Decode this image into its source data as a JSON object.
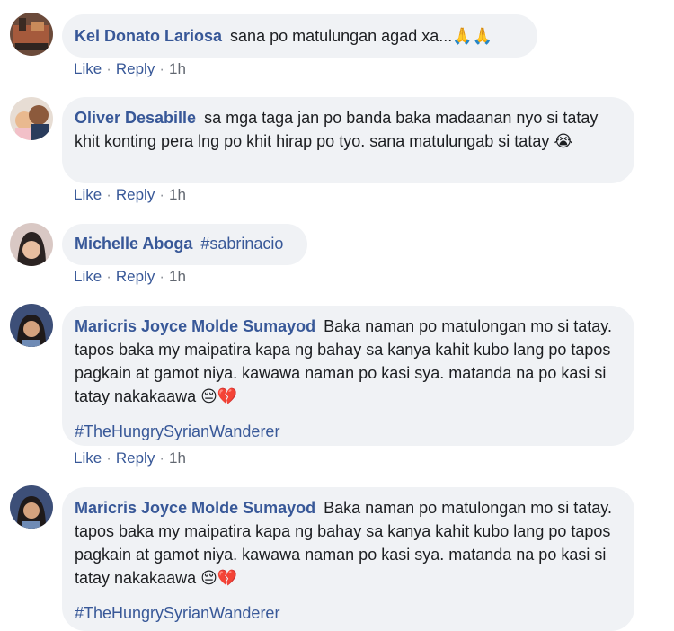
{
  "comments": [
    {
      "author": "Kel Donato Lariosa",
      "text": "sana po matulungan agad xa...",
      "emoji": "🙏🙏",
      "actions": {
        "like": "Like",
        "reply": "Reply",
        "time": "1h"
      }
    },
    {
      "author": "Oliver Desabille",
      "text": "sa mga taga jan po banda baka madaanan nyo si tatay khit konting pera lng po khit hirap po tyo. sana matulungab si tatay",
      "emoji": "😭",
      "actions": {
        "like": "Like",
        "reply": "Reply",
        "time": "1h"
      }
    },
    {
      "author": "Michelle Aboga",
      "text": "#sabrinacio",
      "actions": {
        "like": "Like",
        "reply": "Reply",
        "time": "1h"
      }
    },
    {
      "author": "Maricris Joyce Molde Sumayod",
      "text": "Baka naman po matulongan mo si tatay. tapos baka my maipatira kapa ng bahay sa kanya kahit kubo lang po tapos pagkain at gamot niya. kawawa naman po kasi sya. matanda na po kasi si tatay nakakaawa",
      "emoji": "😔💔",
      "hashtag": "#TheHungrySyrianWanderer",
      "actions": {
        "like": "Like",
        "reply": "Reply",
        "time": "1h"
      }
    },
    {
      "author": "Maricris Joyce Molde Sumayod",
      "text": "Baka naman po matulongan mo si tatay. tapos baka my maipatira kapa ng bahay sa kanya kahit kubo lang po tapos pagkain at gamot niya. kawawa naman po kasi sya. matanda na po kasi si tatay nakakaawa",
      "emoji": "😔💔",
      "hashtag": "#TheHungrySyrianWanderer"
    }
  ],
  "separator": "·",
  "colors": {
    "link": "#385898",
    "bubble": "#f0f2f5",
    "text": "#1c1e21"
  }
}
